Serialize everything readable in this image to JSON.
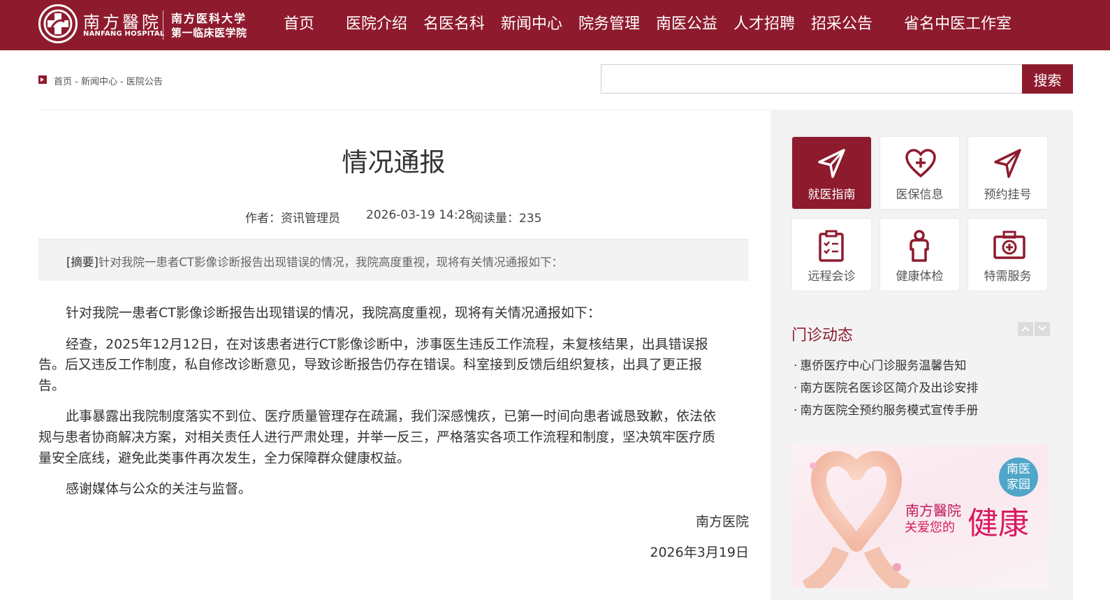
{
  "header": {
    "logo_cn": "南方醫院",
    "logo_en": "NANFANG HOSPITAL",
    "uni_line1": "南方医科大学",
    "uni_line2": "第一临床医学院",
    "nav": [
      "首页",
      "医院介绍",
      "名医名科",
      "新闻中心",
      "院务管理",
      "南医公益",
      "人才招聘",
      "招采公告",
      "省名中医工作室"
    ]
  },
  "breadcrumb": "首页 - 新闻中心 - 医院公告",
  "search": {
    "placeholder": "",
    "button": "搜索"
  },
  "article": {
    "title": "情况通报",
    "author": "作者：资讯管理员",
    "datetime": "2026-03-19 14:28",
    "views": "阅读量：235",
    "summary_tag": "[摘要]",
    "summary": "针对我院一患者CT影像诊断报告出现错误的情况，我院高度重视，现将有关情况通报如下：",
    "p1": "针对我院一患者CT影像诊断报告出现错误的情况，我院高度重视，现将有关情况通报如下：",
    "p2a": "经查，2025年12月12日，在对该患者进行CT影像诊断中，涉事医生违反工作流程，未复核结果，出具错误报",
    "p2b": "告。后又违反工作制度，私自修改诊断意见，导致诊断报告仍存在错误。科室接到反馈后组织复核，出具了更正报",
    "p2c": "告。",
    "p3a": "此事暴露出我院制度落实不到位、医疗质量管理存在疏漏，我们深感愧疚，已第一时间向患者诚恳致歉，依法依",
    "p3b": "规与患者协商解决方案，对相关责任人进行严肃处理，并举一反三，严格落实各项工作流程和制度，坚决筑牢医疗质",
    "p3c": "量安全底线，避免此类事件再次发生，全力保障群众健康权益。",
    "p4": "感谢媒体与公众的关注与监督。",
    "sign_org": "南方医院",
    "sign_date": "2026年3月19日"
  },
  "sidebar": {
    "tiles": [
      {
        "label": "就医指南",
        "icon": "send-icon"
      },
      {
        "label": "医保信息",
        "icon": "heart-plus-icon"
      },
      {
        "label": "预约挂号",
        "icon": "send-icon"
      },
      {
        "label": "远程会诊",
        "icon": "clipboard-icon"
      },
      {
        "label": "健康体检",
        "icon": "person-icon"
      },
      {
        "label": "特需服务",
        "icon": "medical-kit-icon"
      }
    ],
    "section_title": "门诊动态",
    "news": [
      "惠侨医疗中心门诊服务温馨告知",
      "南方医院名医诊区简介及出诊安排",
      "南方医院全预约服务模式宣传手册"
    ],
    "banner": {
      "badge": [
        "南医",
        "家园"
      ],
      "logo_cn": "南方醫院",
      "care": "关爱您的",
      "big": "健康"
    }
  },
  "colors": {
    "brand": "#8e1b2d",
    "sidebar_bg": "#f3f3f3",
    "banner_pink": "#d81b60"
  }
}
